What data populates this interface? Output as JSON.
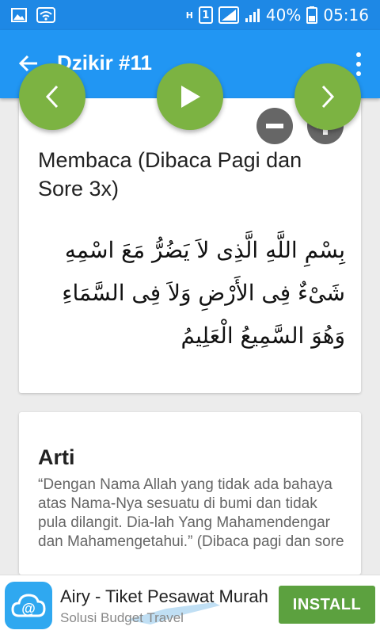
{
  "status_bar": {
    "battery_percent": "40%",
    "time": "05:16",
    "network_badge": "1",
    "data_badge": "H"
  },
  "app_bar": {
    "title": "Dzikir #11"
  },
  "dzikir_card": {
    "title": "Membaca (Dibaca Pagi dan Sore 3x)",
    "arabic_text": "بِسْمِ اللَّهِ الَّذِى لاَ يَضُرُّ مَعَ اسْمِهِ شَىْءٌ فِى الأَرْضِ وَلاَ فِى السَّمَاءِ وَهُوَ السَّمِيعُ الْعَلِيمُ"
  },
  "arti_card": {
    "title": "Arti",
    "text": "“Dengan Nama Allah yang tidak ada bahaya atas Nama-Nya sesuatu di bumi dan tidak pula dilangit. Dia-lah Yang Mahamendengar dan Mahamengetahui.” (Dibaca pagi dan sore"
  },
  "ad": {
    "title": "Airy - Tiket Pesawat Murah",
    "subtitle": "Solusi Budget Travel",
    "install_label": "INSTALL"
  },
  "colors": {
    "status_bar": "#1e88e5",
    "app_bar": "#2196f3",
    "fab": "#7cb342",
    "install": "#5ca13f"
  }
}
